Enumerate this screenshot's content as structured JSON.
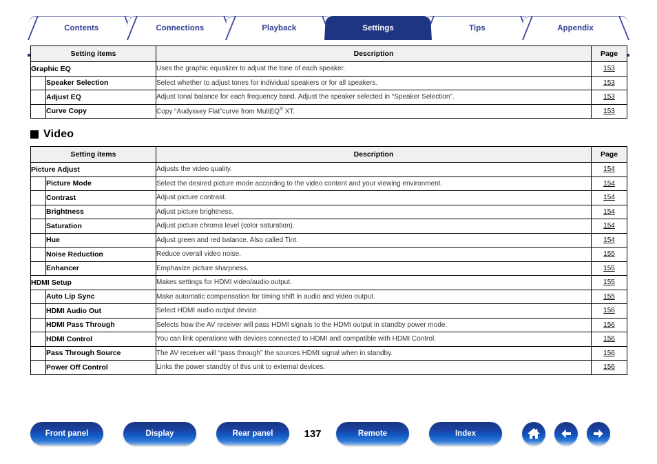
{
  "tabs": [
    {
      "label": "Contents",
      "active": false
    },
    {
      "label": "Connections",
      "active": false
    },
    {
      "label": "Playback",
      "active": false
    },
    {
      "label": "Settings",
      "active": true
    },
    {
      "label": "Tips",
      "active": false
    },
    {
      "label": "Appendix",
      "active": false
    }
  ],
  "table_headers": {
    "setting_items": "Setting items",
    "description": "Description",
    "page": "Page"
  },
  "audio_table": {
    "rows": [
      {
        "indent": false,
        "item": "Graphic EQ",
        "desc": "Uses the graphic equalizer to adjust the tone of each speaker.",
        "page": "153"
      },
      {
        "indent": true,
        "item": "Speaker Selection",
        "desc": "Select whether to adjust tones for individual speakers or for all speakers.",
        "page": "153"
      },
      {
        "indent": true,
        "item": "Adjust EQ",
        "desc": "Adjust tonal balance for each frequency band. Adjust the speaker selected in “Speaker Selection”.",
        "page": "153"
      },
      {
        "indent": true,
        "item": "Curve Copy",
        "desc": "Copy “Audyssey Flat”curve from MultEQ® XT.",
        "page": "153"
      }
    ]
  },
  "video_section": {
    "heading": "Video",
    "rows": [
      {
        "indent": false,
        "item": "Picture Adjust",
        "desc": "Adjusts the video quality.",
        "page": "154"
      },
      {
        "indent": true,
        "item": "Picture Mode",
        "desc": "Select the desired picture mode according to the video content and your viewing environment.",
        "page": "154"
      },
      {
        "indent": true,
        "item": "Contrast",
        "desc": "Adjust picture contrast.",
        "page": "154"
      },
      {
        "indent": true,
        "item": "Brightness",
        "desc": "Adjust picture brightness.",
        "page": "154"
      },
      {
        "indent": true,
        "item": "Saturation",
        "desc": "Adjust picture chroma level (color saturation).",
        "page": "154"
      },
      {
        "indent": true,
        "item": "Hue",
        "desc": "Adjust green and red balance. Also called Tint.",
        "page": "154"
      },
      {
        "indent": true,
        "item": "Noise Reduction",
        "desc": "Reduce overall video noise.",
        "page": "155"
      },
      {
        "indent": true,
        "item": "Enhancer",
        "desc": "Emphasize picture sharpness.",
        "page": "155"
      },
      {
        "indent": false,
        "item": "HDMI Setup",
        "desc": "Makes settings for HDMI video/audio output.",
        "page": "155"
      },
      {
        "indent": true,
        "item": "Auto Lip Sync",
        "desc": "Make automatic compensation for timing shift in audio and video output.",
        "page": "155"
      },
      {
        "indent": true,
        "item": "HDMI Audio Out",
        "desc": "Select HDMI audio output device.",
        "page": "156"
      },
      {
        "indent": true,
        "item": "HDMI Pass Through",
        "desc": "Selects how the AV receiver will pass HDMI signals to the HDMI output in standby power mode.",
        "page": "156"
      },
      {
        "indent": true,
        "item": "HDMI Control",
        "desc": "You can link operations with devices connected to HDMI and compatible with HDMI Control.",
        "page": "156"
      },
      {
        "indent": true,
        "item": "Pass Through Source",
        "desc": "The AV receiver will “pass through” the sources HDMI signal when in standby.",
        "page": "156"
      },
      {
        "indent": true,
        "item": "Power Off Control",
        "desc": "Links the power standby of this unit to external devices.",
        "page": "156"
      }
    ]
  },
  "footer": {
    "buttons": [
      {
        "label": "Front panel"
      },
      {
        "label": "Display"
      },
      {
        "label": "Rear panel"
      }
    ],
    "page_number": "137",
    "buttons_right": [
      {
        "label": "Remote"
      },
      {
        "label": "Index"
      }
    ],
    "icons": [
      {
        "name": "home-icon"
      },
      {
        "name": "arrow-left-icon"
      },
      {
        "name": "arrow-right-icon"
      }
    ]
  },
  "colors": {
    "brand_navy": "#1f3582",
    "tab_text": "#2e3b8f",
    "header_fill": "#f0f0f0"
  }
}
